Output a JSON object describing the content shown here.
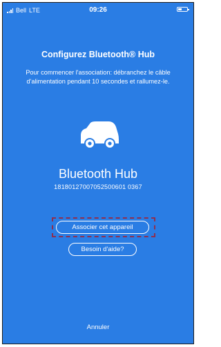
{
  "status_bar": {
    "carrier": "Bell",
    "network": "LTE",
    "time": "09:26"
  },
  "screen": {
    "title": "Configurez Bluetooth® Hub",
    "instructions": "Pour commencer l'association: débranchez le câble d'alimentation pendant 10 secondes et rallumez-le.",
    "device_icon": "car-icon",
    "device_name": "Bluetooth Hub",
    "device_serial": "18180127007052500601 0367"
  },
  "actions": {
    "pair_label": "Associer cet appareil",
    "help_label": "Besoin d'aide?",
    "cancel_label": "Annuler"
  },
  "colors": {
    "background": "#2a7de4",
    "text": "#ffffff",
    "highlight": "#8e2f4f"
  }
}
